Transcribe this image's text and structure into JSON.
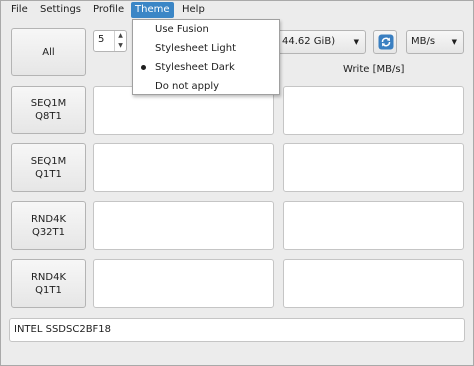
{
  "menu": {
    "items": [
      {
        "label": "File"
      },
      {
        "label": "Settings"
      },
      {
        "label": "Profile"
      },
      {
        "label": "Theme"
      },
      {
        "label": "Help"
      }
    ]
  },
  "theme_menu": {
    "options": [
      {
        "label": "Use Fusion",
        "selected": false
      },
      {
        "label": "Stylesheet Light",
        "selected": false
      },
      {
        "label": "Stylesheet Dark",
        "selected": true
      },
      {
        "label": "Do not apply",
        "selected": false
      }
    ]
  },
  "toolbar": {
    "all_label": "All",
    "count_value": "5",
    "drive_visible_text": "44.62 GiB)",
    "unit_value": "MB/s",
    "refresh_icon": "refresh-icon"
  },
  "columns": {
    "read_label": "",
    "write_label": "Write [MB/s]"
  },
  "tests": [
    {
      "line1": "SEQ1M",
      "line2": "Q8T1",
      "read": "",
      "write": ""
    },
    {
      "line1": "SEQ1M",
      "line2": "Q1T1",
      "read": "",
      "write": ""
    },
    {
      "line1": "RND4K",
      "line2": "Q32T1",
      "read": "",
      "write": ""
    },
    {
      "line1": "RND4K",
      "line2": "Q1T1",
      "read": "",
      "write": ""
    }
  ],
  "status": {
    "drive_model": "INTEL SSDSC2BF18"
  },
  "colors": {
    "menu_highlight": "#3b86c6",
    "refresh_icon": "#3a7fc1"
  }
}
